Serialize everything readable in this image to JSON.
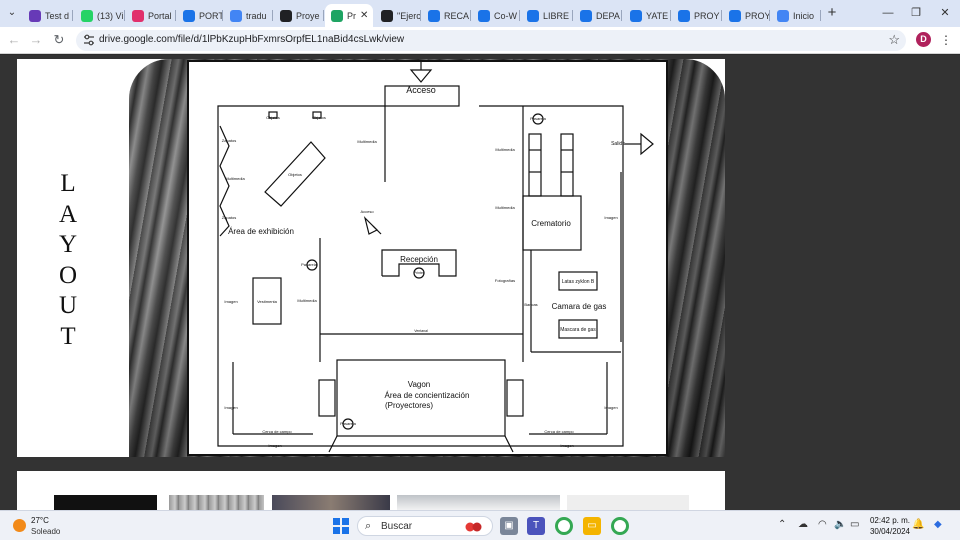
{
  "browser": {
    "tabs": [
      {
        "label": "Test d",
        "icon": "docs-forms-icon",
        "color": "#673ab7"
      },
      {
        "label": "(13) Vi",
        "icon": "whatsapp-icon",
        "color": "#25d366"
      },
      {
        "label": "Portal",
        "icon": "instagram-icon",
        "color": "#e1306c"
      },
      {
        "label": "PORTA",
        "icon": "app-icon",
        "color": "#1a73e8"
      },
      {
        "label": "tradu",
        "icon": "google-icon",
        "color": "#4285f4"
      },
      {
        "label": "Proye",
        "icon": "document-icon",
        "color": "#202124"
      },
      {
        "label": "Pr",
        "icon": "google-drive-icon",
        "color": "#1fa463",
        "active": true
      },
      {
        "label": "\"Ejerc",
        "icon": "document-icon",
        "color": "#202124"
      },
      {
        "label": "RECA",
        "icon": "app-icon",
        "color": "#1a73e8"
      },
      {
        "label": "Co-W",
        "icon": "app-icon",
        "color": "#1a73e8"
      },
      {
        "label": "LIBRE",
        "icon": "bookmark-icon",
        "color": "#1a73e8"
      },
      {
        "label": "DEPA",
        "icon": "app-icon",
        "color": "#1a73e8"
      },
      {
        "label": "YATE",
        "icon": "bookmark-icon",
        "color": "#1a73e8"
      },
      {
        "label": "PROY",
        "icon": "bookmark-icon",
        "color": "#1a73e8"
      },
      {
        "label": "PROY",
        "icon": "bookmark-icon",
        "color": "#1a73e8"
      },
      {
        "label": "Inicio",
        "icon": "google-icon",
        "color": "#4285f4"
      }
    ],
    "url": "drive.google.com/file/d/1lPbKzupHbFxmrsOrpfEL1naBid4csLwk/view",
    "profile_initial": "D"
  },
  "slide": {
    "title_letters": [
      "L",
      "A",
      "Y",
      "O",
      "U",
      "T"
    ]
  },
  "floorplan": {
    "acceso": "Acceso",
    "salida": "Salida",
    "area_exhibicion": "Área de exhibición",
    "recepcion": "Recepción",
    "crematorio": "Crematorio",
    "camara_gas": "Camara de gas",
    "latas_zyklon": "Latas zyklon B",
    "mascara_gas": "Mascara de gas",
    "vagon": "Vagon",
    "area_concientizacion": "Área de concientización",
    "proyectores": "(Proyectores)",
    "small": {
      "objetos": "Objetos",
      "zapatos": "Zapatos",
      "multimedia": "Multimedia",
      "acceso": "Acceso",
      "pasarela": "Pasarela",
      "imagen": "Imagen",
      "vestimenta": "Vestimenta",
      "fotografias": "Fotografías",
      "bancas": "Bancas",
      "cerca_campo": "Cerca de campo",
      "ventanal": "Ventanal",
      "printer": "Printer"
    }
  },
  "taskbar": {
    "temperature": "27°C",
    "weather": "Soleado",
    "search_placeholder": "Buscar",
    "time": "02:42 p. m.",
    "date": "30/04/2024"
  }
}
